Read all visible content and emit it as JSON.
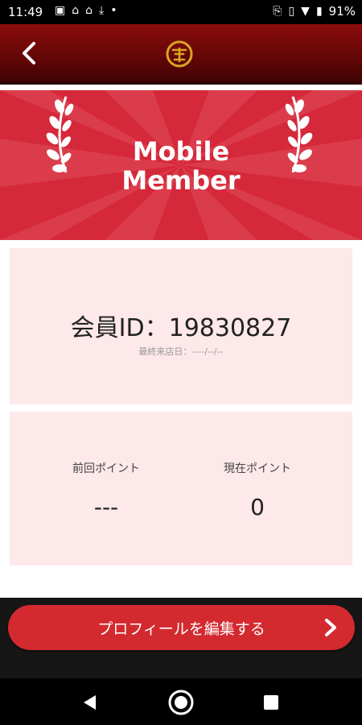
{
  "status_bar": {
    "time": "11:49",
    "battery": "91%",
    "left_icons": [
      "image-icon",
      "store-icon",
      "store-icon",
      "download-done-icon",
      "dot-icon"
    ],
    "right_icons": [
      "cast-icon",
      "vibrate-icon",
      "wifi-icon",
      "battery-icon"
    ]
  },
  "header": {
    "back_icon": "chevron-left-icon",
    "logo_icon": "brand-logo-icon"
  },
  "banner": {
    "title_line1": "Mobile",
    "title_line2": "Member"
  },
  "member": {
    "id_text": "会員ID：19830827",
    "last_visit_text": "最終来店日：----/--/--"
  },
  "points": {
    "previous_label": "前回ポイント",
    "previous_value": "---",
    "current_label": "現在ポイント",
    "current_value": "0"
  },
  "actions": {
    "edit_profile_label": "プロフィールを編集する"
  },
  "colors": {
    "header_dark_red": "#5a0505",
    "banner_red": "#d5283a",
    "card_pink": "#fde8ea",
    "button_red": "#d32a30"
  }
}
